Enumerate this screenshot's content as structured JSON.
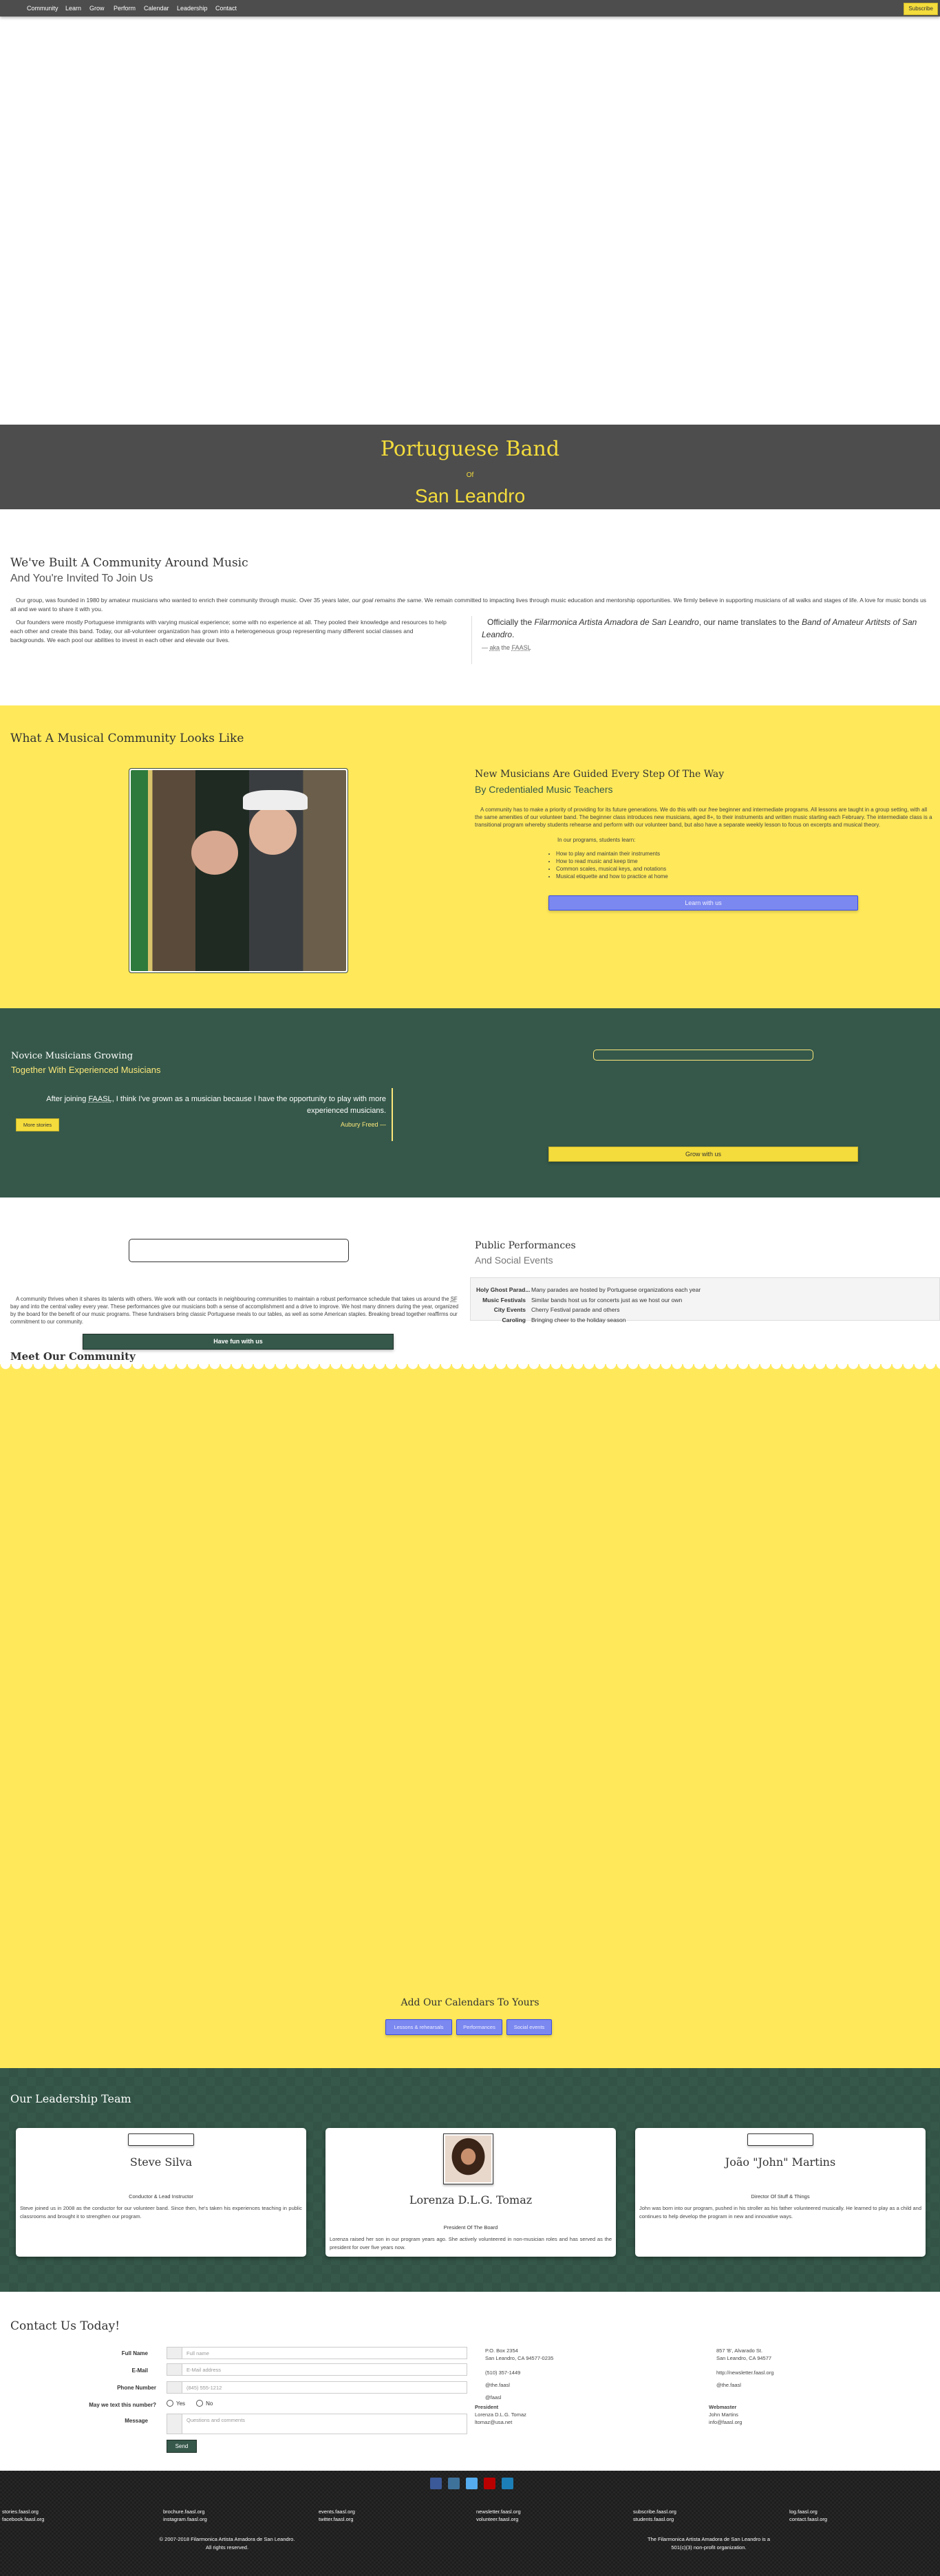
{
  "nav": {
    "items": [
      "Community",
      "Learn",
      "Grow",
      "Perform",
      "Calendar",
      "Leadership",
      "Contact"
    ],
    "subscribe": "Subscribe"
  },
  "hero": {
    "line1": "Portuguese Band",
    "line2": "Of",
    "line3": "San Leandro"
  },
  "community": {
    "title": "We've Built A Community Around Music",
    "subtitle": "And You're Invited To Join Us",
    "p1_a": "Our group, was founded in 1980 by amateur musicians who wanted to enrich their community through music. Over 35 years later, ",
    "p1_em": "our goal remains the same",
    "p1_b": ". We remain committed to impacting lives through music education and mentorship opportunities. We firmly believe in supporting musicians of all walks and stages of life. A love for music bonds us all and we want to share it with you.",
    "p2": "Our founders were mostly Portuguese immigrants with varying musical experience; some with no experience at all. They pooled their knowledge and resources to help each other and create this band. Today, our all-volunteer organization has grown into a heterogeneous group representing many different social classes and backgrounds. We each pool our abilities to invest in each other and elevate our lives.",
    "quote_a": "Officially the ",
    "quote_em1": "Filarmonica Artista Amadora de San Leandro",
    "quote_b": ", our name translates to the ",
    "quote_em2": "Band of Amateur Artitsts of San Leandro",
    "quote_c": ".",
    "cite_dash": "—",
    "cite_a": "aka",
    "cite_b": "the",
    "cite_c": "FAASL"
  },
  "learn": {
    "section_title": "What A Musical Community Looks Like",
    "title": "New Musicians Are Guided Every Step Of The Way",
    "subtitle": "By Credentialed Music Teachers",
    "p_a": "A community has to make a priority of providing for its future generations. We do this with our ",
    "p_em": "free",
    "p_b": " beginner and intermediate programs. All lessons are taught in a group setting, with all the same amenities of our volunteer band. The beginner class introduces new musicians, aged 8+, to their instruments and written music starting each February. The intermediate class is a transitional program whereby students rehearse and perform with our volunteer band, but also have a separate weekly lesson to focus on excerpts and musical theory.",
    "list_intro": "In our programs, students learn:",
    "list": [
      "How to play and maintain their instruments",
      "How to read music and keep time",
      "Common scales, musical keys, and notations",
      "Musical etiquette and how to practice at home"
    ],
    "button": "Learn with us"
  },
  "grow": {
    "title": "Novice Musicians Growing",
    "subtitle": "Together With Experienced Musicians",
    "quote_a": "After joining ",
    "quote_abbr": "FAASL",
    "quote_b": ", I think I've grown as a musician because I have the opportunity to play with more experienced musicians.",
    "cite": "Aubury Freed —",
    "more": "More stories",
    "button": "Grow with us"
  },
  "perform": {
    "p_a": "A community thrives when it shares its talents with others. We work with our contacts in neighbouring communities to maintain a robust performance schedule that takes us around the ",
    "p_abbr": "SF",
    "p_b": " bay and into the central valley every year. These performances give our musicians both a sense of accomplishment and a drive to improve. We host many dinners during the year, organized by the board for the benefit of our music programs. These fundraisers bring classic Portuguese meals to our tables, as well as some American staples. Breaking bread together reaffirms our commitment to our community.",
    "button": "Have fun with us",
    "title": "Public Performances",
    "subtitle": "And Social Events",
    "events": [
      {
        "k": "Holy Ghost Parad...",
        "v": "Many parades are hosted by Portuguese organizations each year"
      },
      {
        "k": "Music Festivals",
        "v": "Similar bands host us for concerts just as we host our own"
      },
      {
        "k": "City Events",
        "v": "Cherry Festival parade and others"
      },
      {
        "k": "Caroling",
        "v": "Bringing cheer to the holiday season"
      }
    ]
  },
  "calendar": {
    "section_title": "Meet Our Community",
    "title": "Add Our Calendars To Yours",
    "buttons": [
      "Lessons & rehearsals",
      "Performances",
      "Social events"
    ]
  },
  "leadership": {
    "title": "Our Leadership Team",
    "members": [
      {
        "name": "Steve Silva",
        "role": "Conductor & Lead Instructor",
        "bio": "Steve joined us in 2008 as the conductor for our volunteer band. Since then, he's taken his experiences teaching in public classrooms and brought it to strengthen our program."
      },
      {
        "name": "Lorenza D.L.G. Tomaz",
        "role": "President Of The Board",
        "bio": "Lorenza raised her son in our program years ago. She actively volunteered in non-musician roles and has served as the president for over five years now."
      },
      {
        "name": "João \"John\" Martins",
        "role": "Director Of Stuff & Things",
        "bio": "John was born into our program, pushed in his stroller as his father volunteered musically. He learned to play as a child and continues to help develop the program in new and innovative ways."
      }
    ]
  },
  "contact": {
    "title": "Contact Us Today!",
    "fields": [
      {
        "label": "Full Name",
        "placeholder": "Full name"
      },
      {
        "label": "E-Mail",
        "placeholder": "E-Mail address"
      },
      {
        "label": "Phone Number",
        "placeholder": "(845) 555-1212"
      },
      {
        "label": "Message",
        "placeholder": "Questions and comments"
      }
    ],
    "text_label": "May we text this number?",
    "yes": "Yes",
    "no": "No",
    "send": "Send",
    "col1": [
      "P.O. Box 2354",
      "San Leandro, CA 94577-0235",
      "(510) 357-1449",
      "@the.faasl",
      "@faasl"
    ],
    "col2": [
      "857 'B', Alvarado St.",
      "San Leandro, CA 94577",
      "http://newsletter.faasl.org",
      "@the.faasl"
    ],
    "president": {
      "label": "President",
      "name": "Lorenza D.L.G. Tomaz",
      "email": "ltomaz@usa.net"
    },
    "webmaster": {
      "label": "Webmaster",
      "name": "John Martins",
      "email": "info@faasl.org"
    }
  },
  "footer": {
    "social": [
      {
        "icon": "facebook",
        "color": "#3b5998"
      },
      {
        "icon": "instagram",
        "color": "#3f729b"
      },
      {
        "icon": "twitter",
        "color": "#55acee"
      },
      {
        "icon": "youtube",
        "color": "#bb0000"
      },
      {
        "icon": "linkedin",
        "color": "#1d7fb7"
      }
    ],
    "links": [
      [
        "stories.faasl.org",
        "facebook.faasl.org"
      ],
      [
        "brochure.faasl.org",
        "instagram.faasl.org"
      ],
      [
        "events.faasl.org",
        "twitter.faasl.org"
      ],
      [
        "newsletter.faasl.org",
        "volunteer.faasl.org"
      ],
      [
        "subscribe.faasl.org",
        "students.faasl.org"
      ],
      [
        "log.faasl.org",
        "contact.faasl.org"
      ]
    ],
    "copyright1": "© 2007-2018 Filarmonica Artista Amadora de San Leandro.",
    "copyright2": "All rights reserved.",
    "nonprofit1": "The Filarmonica Artista Amadora de San Leandro is a",
    "nonprofit2": "501(c)(3) non-profit organization."
  },
  "colors": {
    "yellow": "#ffe95a",
    "green": "#35584a",
    "dark": "#4d4d4d",
    "button_blue": "#7b88f0",
    "accent_yellow": "#f4dc3c"
  }
}
